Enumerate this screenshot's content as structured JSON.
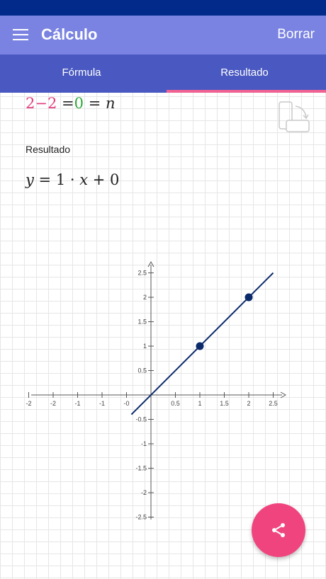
{
  "app": {
    "title": "Cálculo",
    "clear_label": "Borrar"
  },
  "tabs": [
    {
      "label": "Fórmula"
    },
    {
      "label": "Resultado"
    }
  ],
  "active_tab": "Resultado",
  "equation": {
    "left_a": "2",
    "minus": "−",
    "left_b": "2",
    "eq1": "=",
    "value": "0",
    "eq2": "=",
    "var": "n"
  },
  "result": {
    "label": "Resultado",
    "y": "y",
    "eq": " = ",
    "slope": "1",
    "dot": " · ",
    "x": "x",
    "plus": " + ",
    "intercept": "0"
  },
  "colors": {
    "statusbar": "#012a8a",
    "appbar": "#7a83e1",
    "tabs": "#4a59c1",
    "indicator": "#f06292",
    "line": "#0a2a6b",
    "fab": "#f0447f"
  },
  "icons": {
    "menu": "menu-icon",
    "rotate": "screen-rotate-icon",
    "share": "share-icon"
  },
  "chart_data": {
    "type": "line",
    "series": [
      {
        "x": [
          -0.4,
          2.5
        ],
        "y": [
          -0.4,
          2.5
        ]
      }
    ],
    "points": [
      {
        "x": 1,
        "y": 1
      },
      {
        "x": 2,
        "y": 2
      }
    ],
    "xlim": [
      -2,
      2.5
    ],
    "ylim": [
      -2.5,
      2.5
    ],
    "x_ticks": [
      "-2",
      "-2",
      "-1",
      "-1",
      "-0",
      "0.5",
      "1",
      "1.5",
      "2",
      "2.5"
    ],
    "x_tick_values": [
      -2.5,
      -2,
      -1.5,
      -1,
      -0.5,
      0.5,
      1,
      1.5,
      2,
      2.5
    ],
    "y_ticks": [
      "2.5",
      "2",
      "1.5",
      "1",
      "0.5",
      "-0.5",
      "-1",
      "-1.5",
      "-2",
      "-2.5"
    ],
    "y_tick_values": [
      2.5,
      2,
      1.5,
      1,
      0.5,
      -0.5,
      -1,
      -1.5,
      -2,
      -2.5
    ]
  }
}
